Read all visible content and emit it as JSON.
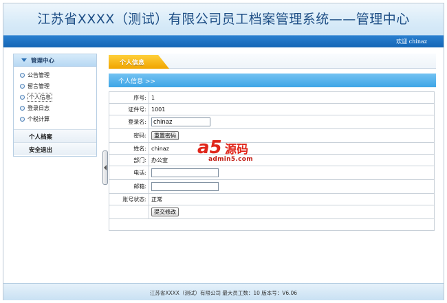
{
  "header": {
    "title": "江苏省XXXX（测试）有限公司员工档案管理系统——管理中心"
  },
  "welcome": {
    "text": "欢迎 chinaz"
  },
  "sidebar": {
    "heading": "管理中心",
    "items": [
      {
        "label": "公告管理",
        "icon": "radio-bullet-icon"
      },
      {
        "label": "留言管理",
        "icon": "radio-bullet-icon"
      },
      {
        "label": "个人信息",
        "icon": "radio-bullet-icon",
        "active": true
      },
      {
        "label": "登录日志",
        "icon": "radio-bullet-icon"
      },
      {
        "label": "个税计算",
        "icon": "radio-bullet-icon"
      }
    ],
    "sections": [
      "个人档案",
      "安全退出"
    ]
  },
  "main": {
    "tab": "个人信息",
    "subheader": "个人信息 >>",
    "fields": {
      "id_label": "序号:",
      "id_value": "1",
      "cert_label": "证件号:",
      "cert_value": "1001",
      "login_label": "登录名:",
      "login_value": "chinaz",
      "pwd_label": "密码:",
      "pwd_button": "重置密码",
      "name_label": "姓名:",
      "name_value": "chinaz",
      "dept_label": "部门:",
      "dept_value": "办公室",
      "phone_label": "电话:",
      "phone_value": "",
      "email_label": "邮箱:",
      "email_value": "",
      "status_label": "账号状态:",
      "status_value": "正常",
      "submit_button": "提交修改"
    }
  },
  "watermark": {
    "logo": "a5",
    "brand": "源码",
    "site": "admin5.com"
  },
  "footer": {
    "text": "江苏省XXXX（测试）有限公司 最大员工数：10 版本号：V6.06"
  },
  "colors": {
    "header_blue": "#1f4f86",
    "bar_blue": "#1466b6",
    "tab_orange": "#f0a500",
    "sub_blue": "#3da5e6",
    "watermark_red": "#e0261b"
  }
}
